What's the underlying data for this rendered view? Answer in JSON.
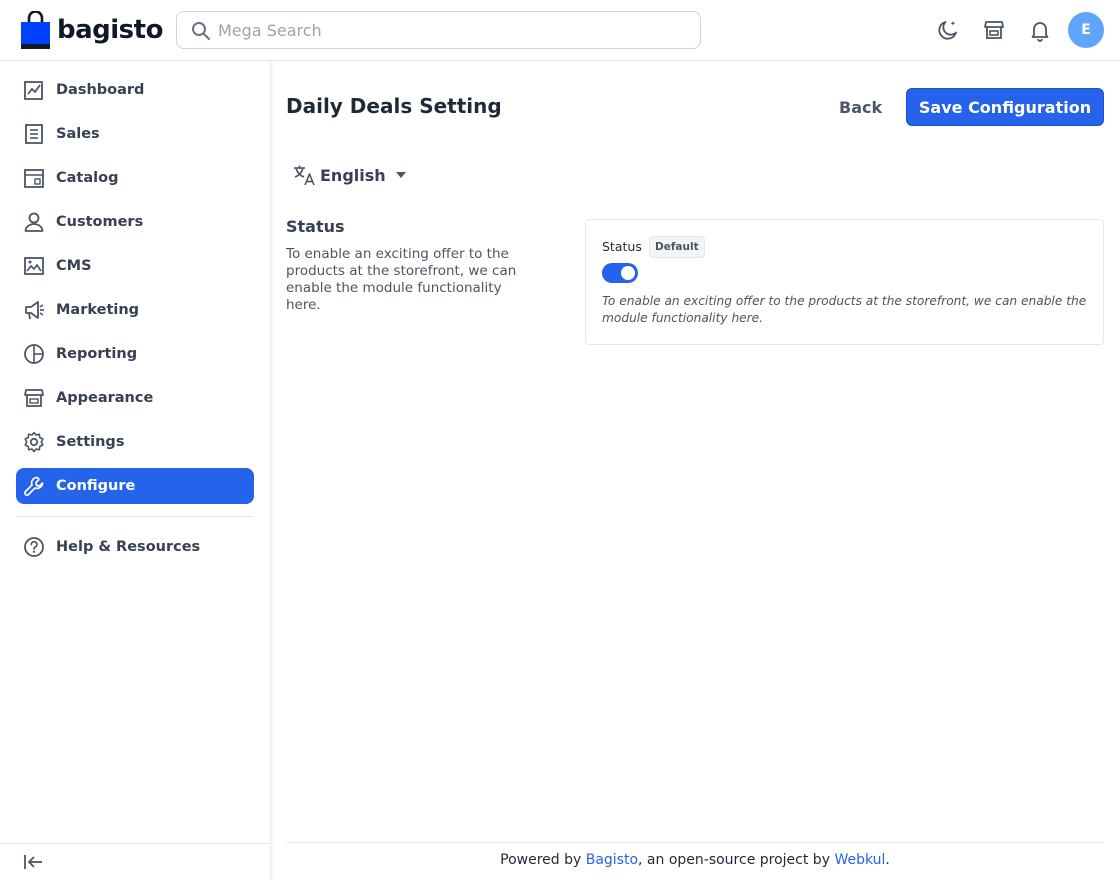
{
  "header": {
    "logo_text": "bagisto",
    "search_placeholder": "Mega Search",
    "avatar_initial": "E"
  },
  "sidebar": {
    "items": [
      {
        "label": "Dashboard",
        "icon": "dashboard-icon"
      },
      {
        "label": "Sales",
        "icon": "sales-icon"
      },
      {
        "label": "Catalog",
        "icon": "catalog-icon"
      },
      {
        "label": "Customers",
        "icon": "customers-icon"
      },
      {
        "label": "CMS",
        "icon": "cms-icon"
      },
      {
        "label": "Marketing",
        "icon": "megaphone-icon"
      },
      {
        "label": "Reporting",
        "icon": "pie-chart-icon"
      },
      {
        "label": "Appearance",
        "icon": "store-icon"
      },
      {
        "label": "Settings",
        "icon": "gear-icon"
      },
      {
        "label": "Configure",
        "icon": "wrench-icon",
        "active": true
      }
    ],
    "help_label": "Help & Resources"
  },
  "main": {
    "title": "Daily Deals Setting",
    "back_label": "Back",
    "save_label": "Save Configuration",
    "locale": "English",
    "section": {
      "title": "Status",
      "description": "To enable an exciting offer to the products at the storefront, we can enable the module functionality here."
    },
    "field": {
      "label": "Status",
      "badge": "Default",
      "enabled": true,
      "help": "To enable an exciting offer to the products at the storefront, we can enable the module functionality here."
    }
  },
  "footer": {
    "prefix": "Powered by ",
    "link1": "Bagisto",
    "middle": ", an open-source project by ",
    "link2": "Webkul",
    "suffix": "."
  },
  "colors": {
    "accent": "#2563eb",
    "avatar": "#60a5fa"
  }
}
